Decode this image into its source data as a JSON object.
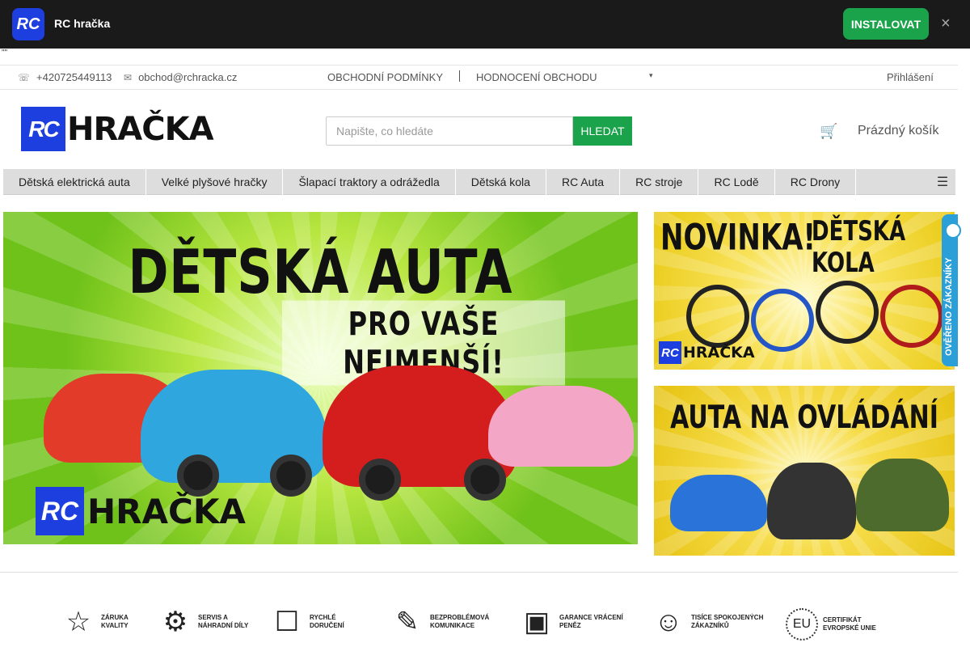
{
  "pwa": {
    "logo_text": "RC",
    "title": "RC hračka",
    "install_label": "INSTALOVAT",
    "close_symbol": "×"
  },
  "stray_text": "\"\"",
  "topbar": {
    "phone": "+420725449113",
    "email": "obchod@rchracka.cz",
    "links": [
      "OBCHODNÍ PODMÍNKY",
      "HODNOCENÍ OBCHODU"
    ],
    "login": "Přihlášení",
    "icons": [
      "phone-icon",
      "mail-icon",
      "dropdown-icon"
    ]
  },
  "header": {
    "logo_box": "RC",
    "logo_word": "HRAČKA",
    "search_placeholder": "Napište, co hledáte",
    "search_button": "HLEDAT",
    "cart_label": "Prázdný košík",
    "cart_icon": "cart-icon"
  },
  "nav": {
    "items": [
      "Dětská elektrická auta",
      "Velké plyšové hračky",
      "Šlapací traktory a odrážedla",
      "Dětská kola",
      "RC Auta",
      "RC stroje",
      "RC Lodě",
      "RC Drony"
    ],
    "more_icon": "menu-more-icon"
  },
  "banners": {
    "main": {
      "title": "DĚTSKÁ AUTA",
      "subtitle": "PRO VAŠE NEJMENŠÍ!",
      "logo_box": "RC",
      "logo_word": "HRAČKA"
    },
    "side1": {
      "left": "NOVINKA!",
      "right": "DĚTSKÁ KOLA",
      "logo_box": "RC",
      "logo_word": "HRAČKA"
    },
    "side2": {
      "title": "AUTA NA OVLÁDÁNÍ"
    }
  },
  "verified_badge": "OVĚŘENO ZÁKAZNÍKY",
  "benefits": [
    {
      "icon": "☆",
      "label": "ZÁRUKA KVALITY"
    },
    {
      "icon": "⚙",
      "label": "SERVIS A NÁHRADNÍ DÍLY"
    },
    {
      "icon": "☐",
      "label": "RYCHLÉ DORUČENÍ"
    },
    {
      "icon": "✎",
      "label": "BEZPROBLÉMOVÁ KOMUNIKACE"
    },
    {
      "icon": "▣",
      "label": "GARANCE VRÁCENÍ PENĚZ"
    },
    {
      "icon": "☺",
      "label": "TISÍCE SPOKOJENÝCH ZÁKAZNÍKŮ"
    },
    {
      "icon": "EU",
      "label": "CERTIFIKÁT EVROPSKÉ UNIE"
    }
  ],
  "colors": {
    "brand_blue": "#1e3fe0",
    "accent_green": "#1aa34a",
    "pwa_bar": "#1a1a1a",
    "verified_blue": "#2a9fd8"
  }
}
